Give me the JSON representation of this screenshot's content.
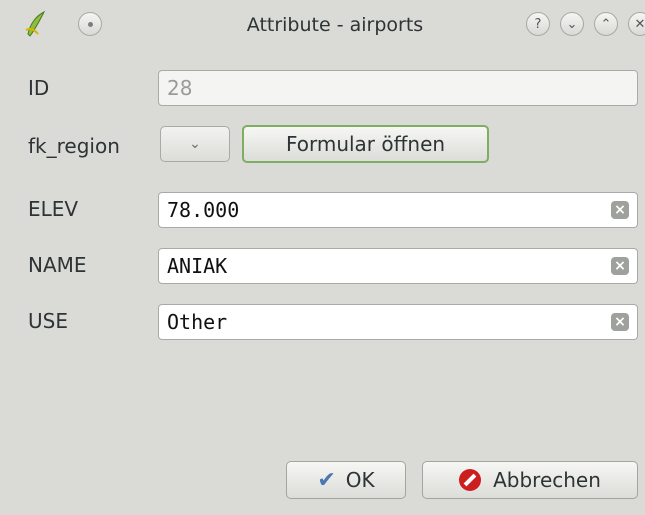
{
  "window": {
    "title": "Attribute - airports"
  },
  "titlebar_buttons": [
    {
      "name": "help",
      "glyph": "?"
    },
    {
      "name": "minimize",
      "glyph": "⌄"
    },
    {
      "name": "maximize",
      "glyph": "⌃"
    },
    {
      "name": "close",
      "glyph": "✕"
    }
  ],
  "form": {
    "id": {
      "label": "ID",
      "value": "28"
    },
    "fk_region": {
      "label": "fk_region",
      "combo_value": "",
      "open_form_label": "Formular öffnen"
    },
    "elev": {
      "label": "ELEV",
      "value": "78.000"
    },
    "name": {
      "label": "NAME",
      "value": "ANIAK"
    },
    "use": {
      "label": "USE",
      "value": "Other"
    }
  },
  "buttons": {
    "ok_label": "OK",
    "cancel_label": "Abbrechen"
  },
  "colors": {
    "window_bg": "#dadad7",
    "focus_green": "#7fae63",
    "cancel_red": "#cc2020",
    "ok_blue": "#4a78b0"
  }
}
